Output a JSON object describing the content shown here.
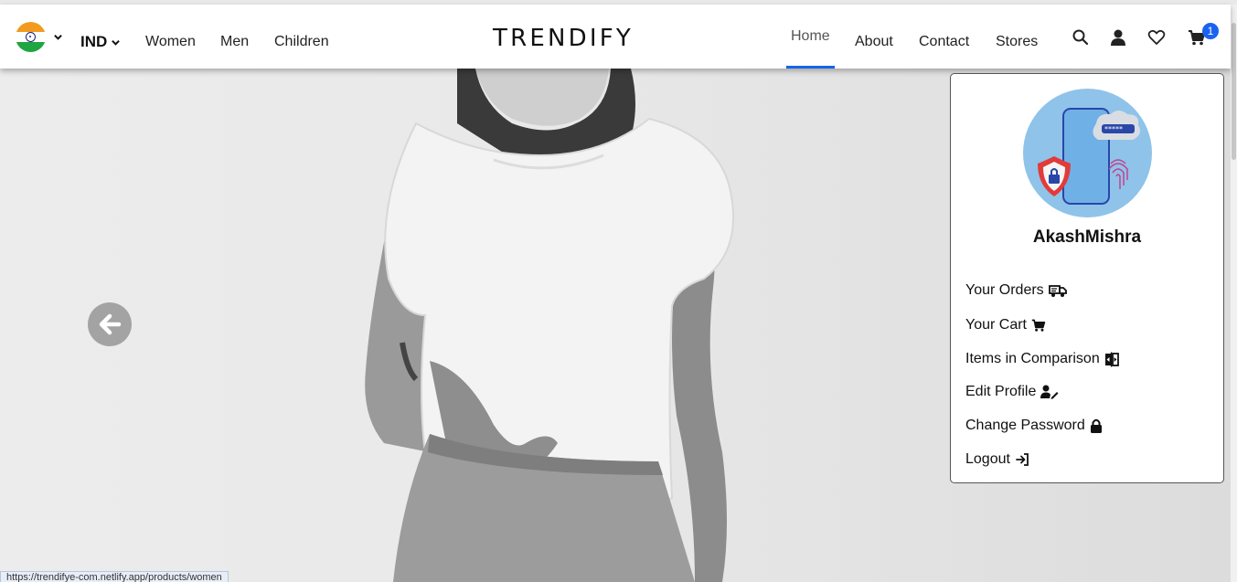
{
  "header": {
    "country_code": "IND",
    "nav_left": [
      "Women",
      "Men",
      "Children"
    ],
    "brand": "TRENDIFY",
    "nav_right": [
      "Home",
      "About",
      "Contact",
      "Stores"
    ],
    "active_nav": "Home",
    "cart_count": "1",
    "icons": [
      "india-flag-icon",
      "chevron-down-icon",
      "search-icon",
      "user-icon",
      "heart-icon",
      "cart-icon"
    ]
  },
  "hero": {
    "prev_icon": "arrow-left-icon"
  },
  "profile_menu": {
    "username": "AkashMishra",
    "items": [
      {
        "label": "Your Orders",
        "icon": "truck-icon"
      },
      {
        "label": "Your Cart",
        "icon": "cart-icon"
      },
      {
        "label": "Items in Comparison",
        "icon": "compare-icon"
      },
      {
        "label": "Edit Profile",
        "icon": "user-edit-icon"
      },
      {
        "label": "Change Password",
        "icon": "lock-icon"
      },
      {
        "label": "Logout",
        "icon": "logout-icon"
      }
    ]
  },
  "status_bar": {
    "url": "https://trendifye-com.netlify.app/products/women"
  },
  "colors": {
    "accent": "#1565e6",
    "badge": "#1a63f0",
    "avatar_bg": "#8fc3ea"
  }
}
